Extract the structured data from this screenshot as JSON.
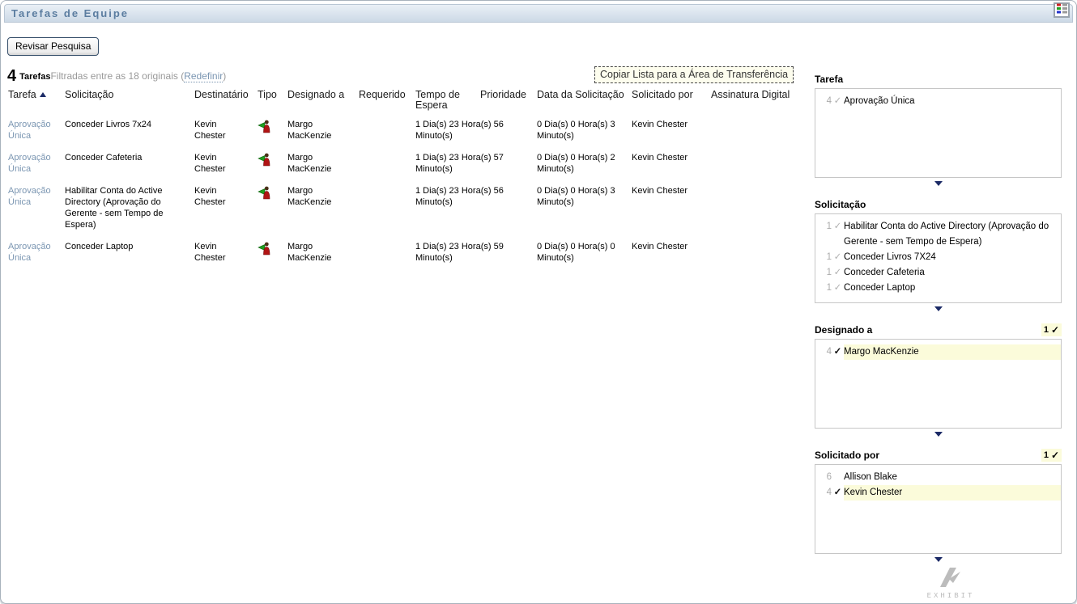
{
  "header": {
    "title": "Tarefas de Equipe"
  },
  "actions": {
    "review_label": "Revisar Pesquisa",
    "copy_label": "Copiar Lista para a Área de Transferência"
  },
  "summary": {
    "count": "4",
    "unit": "Tarefas",
    "filtered_text": "Filtradas entre as 18 originais (",
    "reset_link": "Redefinir",
    "suffix": ")"
  },
  "table": {
    "columns": [
      "Tarefa",
      "Solicitação",
      "Destinatário",
      "Tipo",
      "Designado a",
      "Requerido",
      "Tempo de Espera",
      "Prioridade",
      "Data da Solicitação",
      "Solicitado por",
      "Assinatura Digital"
    ],
    "rows": [
      {
        "tarefa": "Aprovação Única",
        "solicitacao": "Conceder Livros 7x24",
        "destinatario": "Kevin Chester",
        "designado": "Margo MacKenzie",
        "tempo_espera": "1 Dia(s) 23 Hora(s) 56 Minuto(s)",
        "data_solicitacao": "0 Dia(s) 0 Hora(s) 3 Minuto(s)",
        "solicitado_por": "Kevin Chester"
      },
      {
        "tarefa": "Aprovação Única",
        "solicitacao": "Conceder Cafeteria",
        "destinatario": "Kevin Chester",
        "designado": "Margo MacKenzie",
        "tempo_espera": "1 Dia(s) 23 Hora(s) 57 Minuto(s)",
        "data_solicitacao": "0 Dia(s) 0 Hora(s) 2 Minuto(s)",
        "solicitado_por": "Kevin Chester"
      },
      {
        "tarefa": "Aprovação Única",
        "solicitacao": "Habilitar Conta do Active Directory (Aprovação do Gerente - sem Tempo de Espera)",
        "destinatario": "Kevin Chester",
        "designado": "Margo MacKenzie",
        "tempo_espera": "1 Dia(s) 23 Hora(s) 56 Minuto(s)",
        "data_solicitacao": "0 Dia(s) 0 Hora(s) 3 Minuto(s)",
        "solicitado_por": "Kevin Chester"
      },
      {
        "tarefa": "Aprovação Única",
        "solicitacao": "Conceder Laptop",
        "destinatario": "Kevin Chester",
        "designado": "Margo MacKenzie",
        "tempo_espera": "1 Dia(s) 23 Hora(s) 59 Minuto(s)",
        "data_solicitacao": "0 Dia(s) 0 Hora(s) 0 Minuto(s)",
        "solicitado_por": "Kevin Chester"
      }
    ]
  },
  "filters": [
    {
      "label": "Tarefa",
      "badge": null,
      "items": [
        {
          "count": "4",
          "check": "gray",
          "selected": false,
          "text": "Aprovação Única"
        }
      ]
    },
    {
      "label": "Solicitação",
      "badge": null,
      "items": [
        {
          "count": "1",
          "check": "gray",
          "selected": false,
          "text": "Habilitar Conta do Active Directory (Aprovação do Gerente - sem Tempo de Espera)"
        },
        {
          "count": "1",
          "check": "gray",
          "selected": false,
          "text": "Conceder Livros 7X24"
        },
        {
          "count": "1",
          "check": "gray",
          "selected": false,
          "text": "Conceder Cafeteria"
        },
        {
          "count": "1",
          "check": "gray",
          "selected": false,
          "text": "Conceder Laptop"
        }
      ]
    },
    {
      "label": "Designado a",
      "badge": "1",
      "items": [
        {
          "count": "4",
          "check": "black",
          "selected": true,
          "text": "Margo MacKenzie"
        }
      ]
    },
    {
      "label": "Solicitado por",
      "badge": "1",
      "items": [
        {
          "count": "6",
          "check": "none",
          "selected": false,
          "text": "Allison Blake"
        },
        {
          "count": "4",
          "check": "black",
          "selected": true,
          "text": "Kevin Chester"
        }
      ]
    }
  ],
  "icons": {
    "legend": "column-legend-icon",
    "type": "claimed-task-icon",
    "sort": "sort-ascending-icon",
    "scroll": "scroll-down-icon",
    "check": "check-icon"
  },
  "colors": {
    "accent_link": "#7b96b2",
    "title_text": "#5b7da0",
    "highlight": "#fbfbda",
    "flag_green": "#1f9e1f",
    "person_red": "#b11414"
  },
  "watermark": {
    "text": "EXHIBIT"
  }
}
